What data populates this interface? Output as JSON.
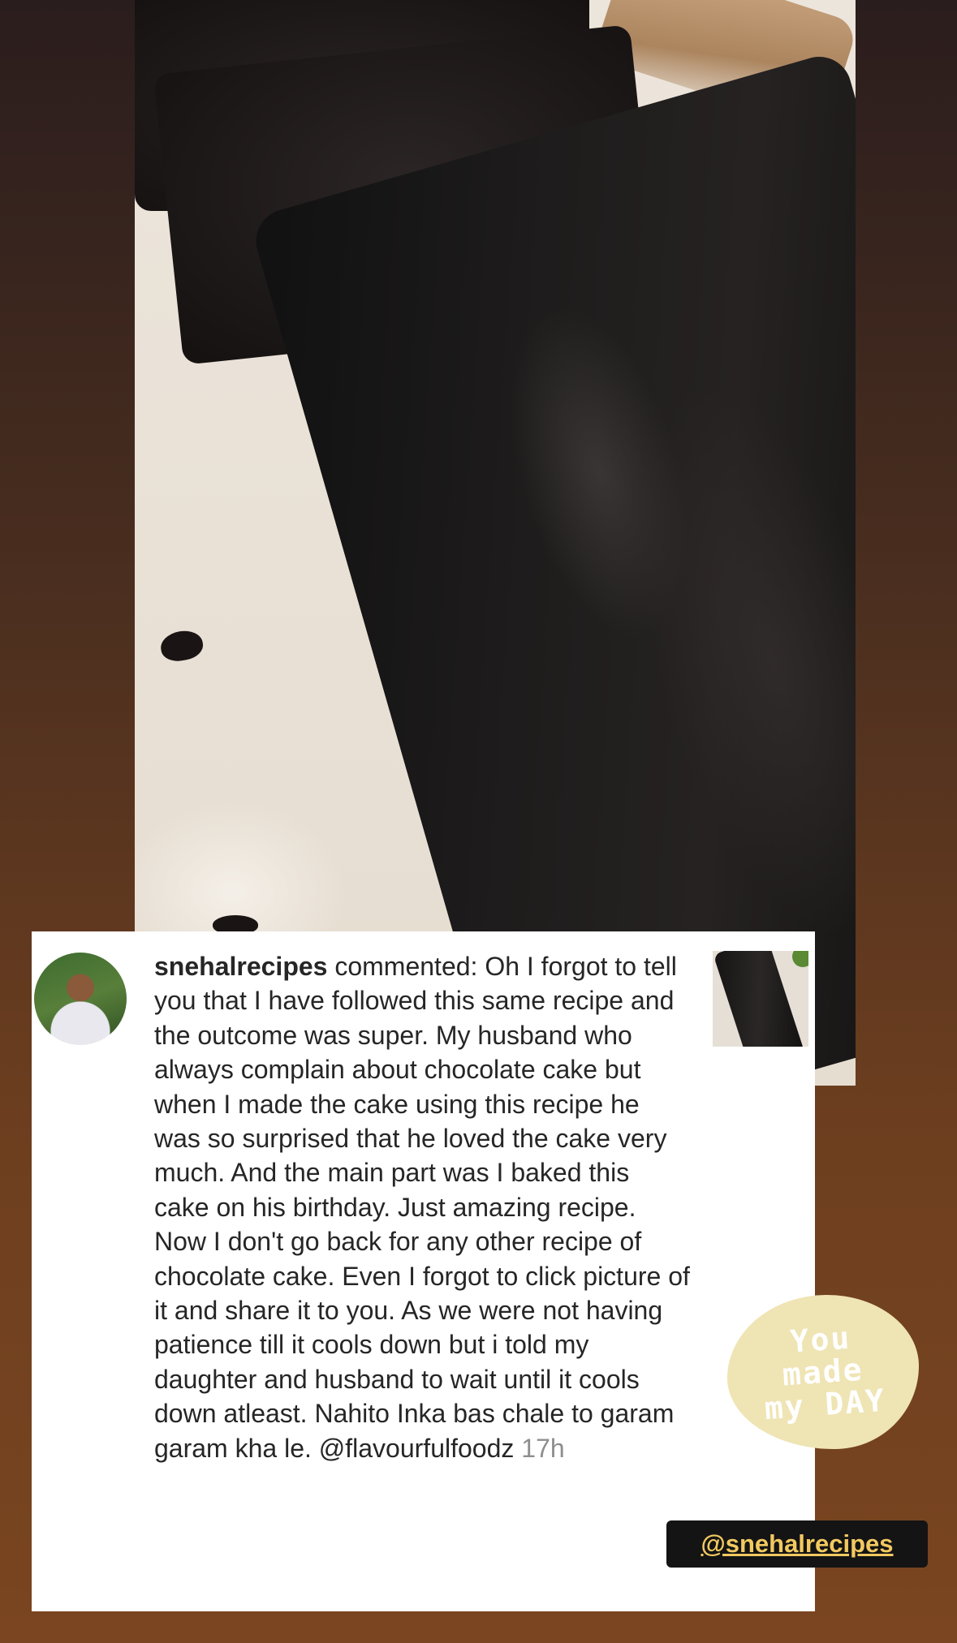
{
  "comment": {
    "username": "snehalrecipes",
    "body": " commented: Oh I forgot to tell you that I have followed this same recipe and the outcome was super. My husband who always complain about chocolate cake but when I made the cake using this recipe he was so surprised that he loved the cake very much. And the main part was I baked this cake on his birthday. Just amazing recipe. Now I don't go back for any other recipe of chocolate cake. Even I forgot to click picture of it and share it to you. As we were not having patience till it cools down but i told my daughter and husband to wait until it cools down atleast. Nahito Inka bas chale to garam garam kha le. @flavourfulfoodz ",
    "time": "17h"
  },
  "sticker": {
    "text": "You\nmade\nmy DAY"
  },
  "mention_tag": {
    "label": "@snehalrecipes"
  },
  "colors": {
    "mention_text": "#f2c960",
    "sticker_bg": "#efe4b4",
    "card_bg": "#ffffff"
  }
}
